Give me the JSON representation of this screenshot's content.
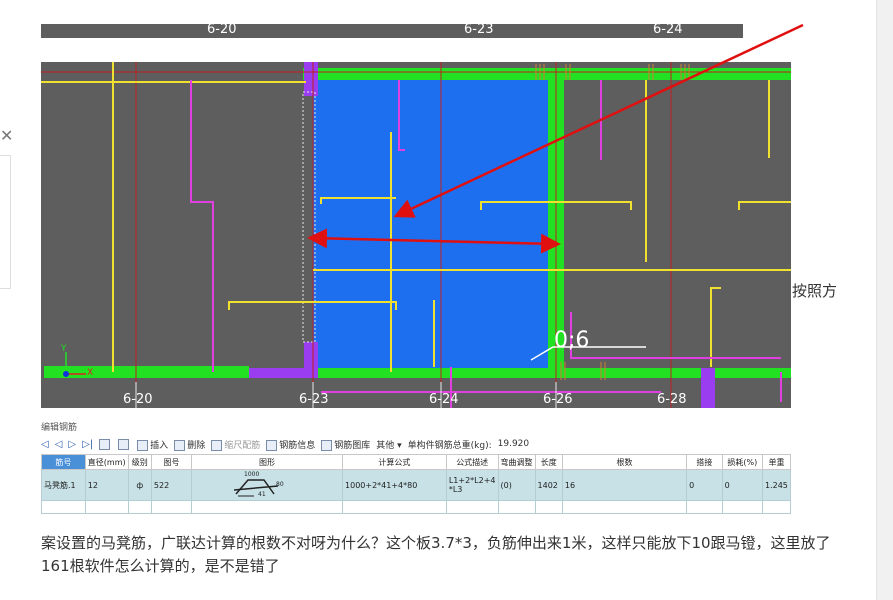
{
  "top_strip": {
    "labels": [
      "6-20",
      "6-23",
      "6-24"
    ]
  },
  "side_text": "按照方",
  "drawing": {
    "axis_labels": [
      "6-20",
      "6-23",
      "6-24",
      "6-26",
      "6-28"
    ],
    "dimension_label": "0;6",
    "ucs_y": "Y",
    "ucs_x": "X"
  },
  "rebar_panel": {
    "title": "编辑钢筋",
    "toolbar": {
      "insert": "插入",
      "delete": "删除",
      "scale_rebar": "缩尺配筋",
      "rebar_info": "钢筋信息",
      "rebar_library": "钢筋图库",
      "other": "其他",
      "total_weight_label": "单构件钢筋总重(kg):",
      "total_weight_value": "19.920"
    },
    "columns": [
      "筋号",
      "直径(mm)",
      "级别",
      "图号",
      "图形",
      "计算公式",
      "公式描述",
      "弯曲调整",
      "长度",
      "根数",
      "搭接",
      "损耗(%)",
      "单重"
    ],
    "row": {
      "name": "马凳筋.1",
      "diameter": "12",
      "grade": "ф",
      "figure_no": "522",
      "shape_top": "1000",
      "shape_right": "80",
      "shape_bottom": "41",
      "formula": "1000+2*41+4*80",
      "formula_desc_1": "L1+2*L2+4",
      "formula_desc_2": "*L3",
      "bend_adjust": "(0)",
      "length": "1402",
      "count": "16",
      "lap": "0",
      "loss": "0",
      "unit_weight": "1.245"
    }
  },
  "body_text": "案设置的马凳筋，广联达计算的根数不对呀为什么？这个板3.7*3，负筋伸出来1米，这样只能放下10跟马镫，这里放了161根软件怎么计算的，是不是错了",
  "colors": {
    "cad_background": "#5e5e5e",
    "slab_fill": "#1e6ff0",
    "beam_green": "#22e022",
    "rebar_yellow": "#f0e030",
    "rebar_magenta": "#e040e0",
    "axis_red": "#c02020",
    "arrow_red": "#e01010",
    "selected_row": "#c7e1e6"
  }
}
